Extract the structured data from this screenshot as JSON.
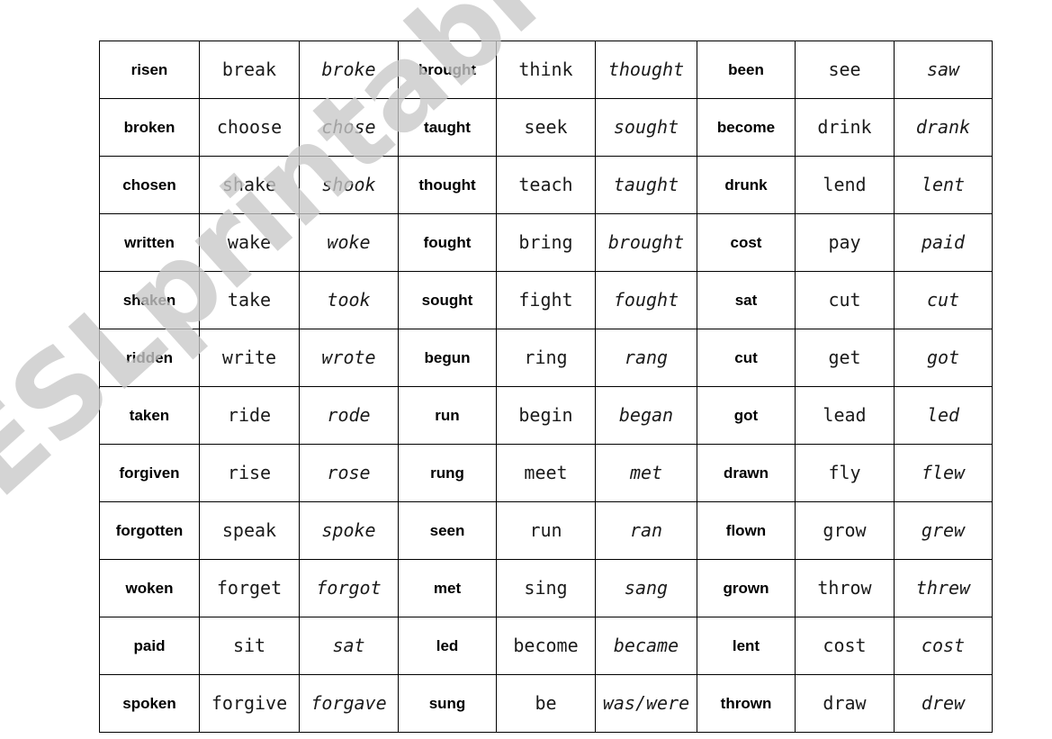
{
  "watermark": {
    "text": "ESLprintables.com",
    "color": "#c9c9c9"
  },
  "table": {
    "rows": 12,
    "columns": 9,
    "column_styles": [
      "bold",
      "mono",
      "mono-italic",
      "bold",
      "mono",
      "mono-italic",
      "bold",
      "mono",
      "mono-italic"
    ],
    "cells": [
      [
        "risen",
        "break",
        "broke",
        "brought",
        "think",
        "thought",
        "been",
        "see",
        "saw"
      ],
      [
        "broken",
        "choose",
        "chose",
        "taught",
        "seek",
        "sought",
        "become",
        "drink",
        "drank"
      ],
      [
        "chosen",
        "shake",
        "shook",
        "thought",
        "teach",
        "taught",
        "drunk",
        "lend",
        "lent"
      ],
      [
        "written",
        "wake",
        "woke",
        "fought",
        "bring",
        "brought",
        "cost",
        "pay",
        "paid"
      ],
      [
        "shaken",
        "take",
        "took",
        "sought",
        "fight",
        "fought",
        "sat",
        "cut",
        "cut"
      ],
      [
        "ridden",
        "write",
        "wrote",
        "begun",
        "ring",
        "rang",
        "cut",
        "get",
        "got"
      ],
      [
        "taken",
        "ride",
        "rode",
        "run",
        "begin",
        "began",
        "got",
        "lead",
        "led"
      ],
      [
        "forgiven",
        "rise",
        "rose",
        "rung",
        "meet",
        "met",
        "drawn",
        "fly",
        "flew"
      ],
      [
        "forgotten",
        "speak",
        "spoke",
        "seen",
        "run",
        "ran",
        "flown",
        "grow",
        "grew"
      ],
      [
        "woken",
        "forget",
        "forgot",
        "met",
        "sing",
        "sang",
        "grown",
        "throw",
        "threw"
      ],
      [
        "paid",
        "sit",
        "sat",
        "led",
        "become",
        "became",
        "lent",
        "cost",
        "cost"
      ],
      [
        "spoken",
        "forgive",
        "forgave",
        "sung",
        "be",
        "was/were",
        "thrown",
        "draw",
        "drew"
      ]
    ]
  }
}
